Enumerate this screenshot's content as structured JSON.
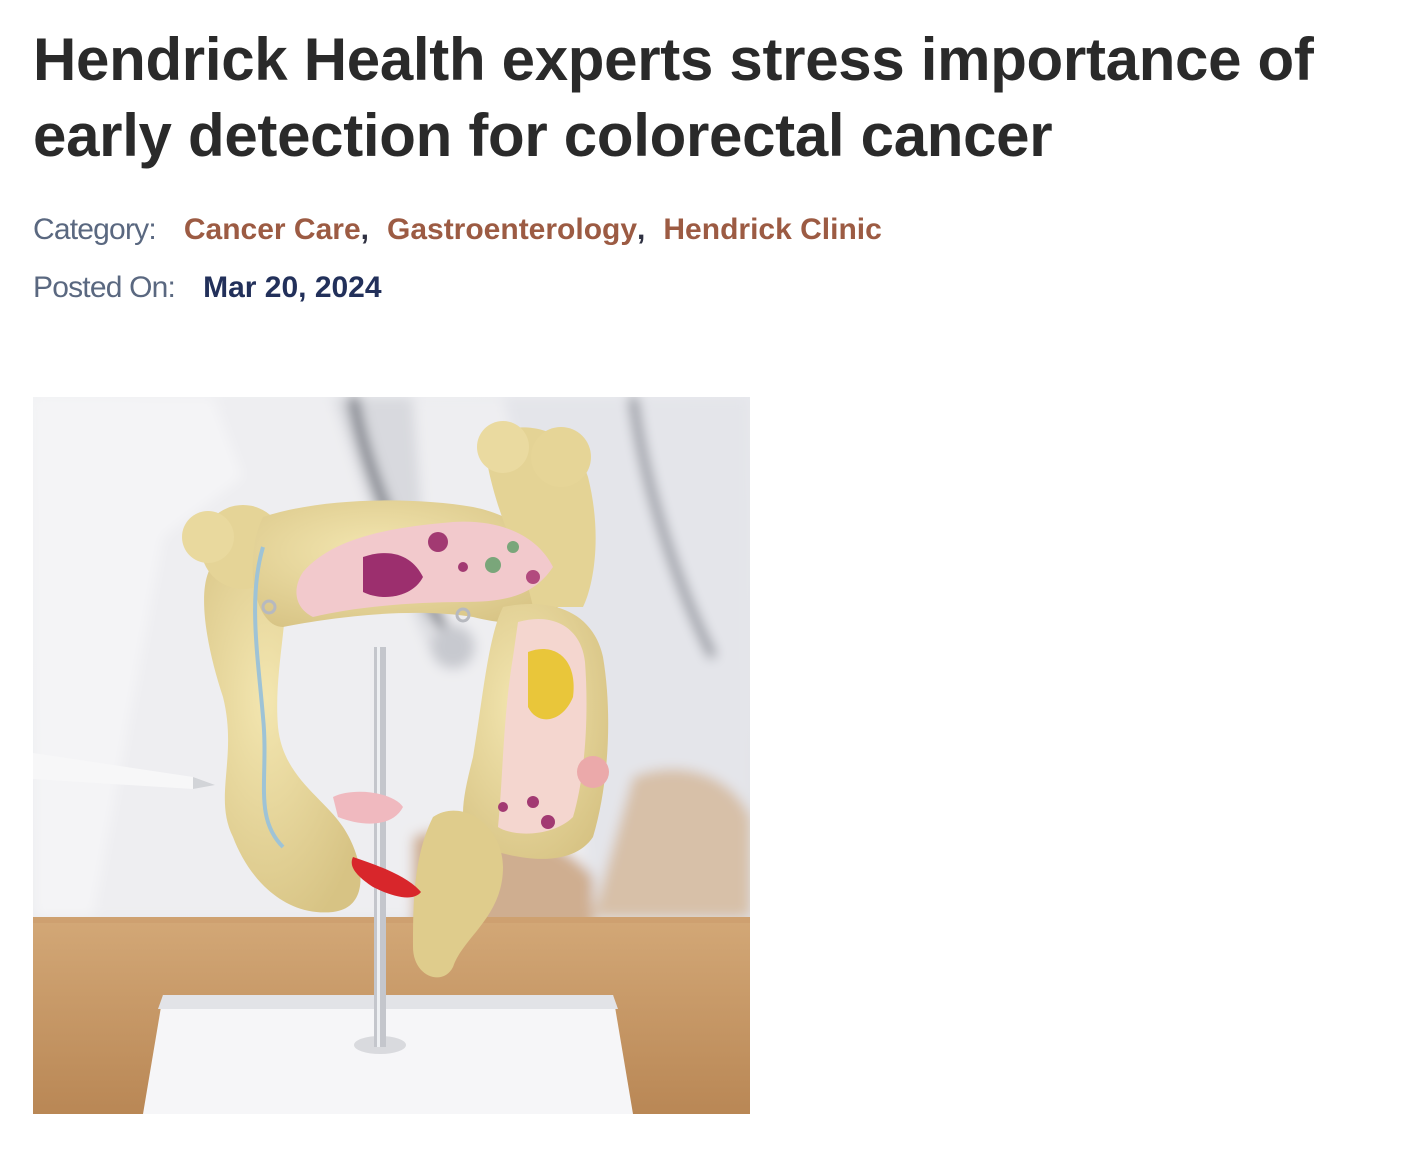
{
  "article": {
    "title": "Hendrick Health experts stress importance of early detection for colorectal cancer",
    "category_label": "Category:",
    "categories": [
      {
        "label": "Cancer Care",
        "separator": ","
      },
      {
        "label": "Gastroenterology",
        "separator": ","
      },
      {
        "label": "Hendrick Clinic",
        "separator": ""
      }
    ],
    "posted_label": "Posted On:",
    "posted_date": "Mar 20, 2024"
  },
  "colors": {
    "title": "#2a2a2a",
    "meta_label": "#5a6880",
    "category_link": "#9c5b43",
    "date": "#22305a"
  }
}
